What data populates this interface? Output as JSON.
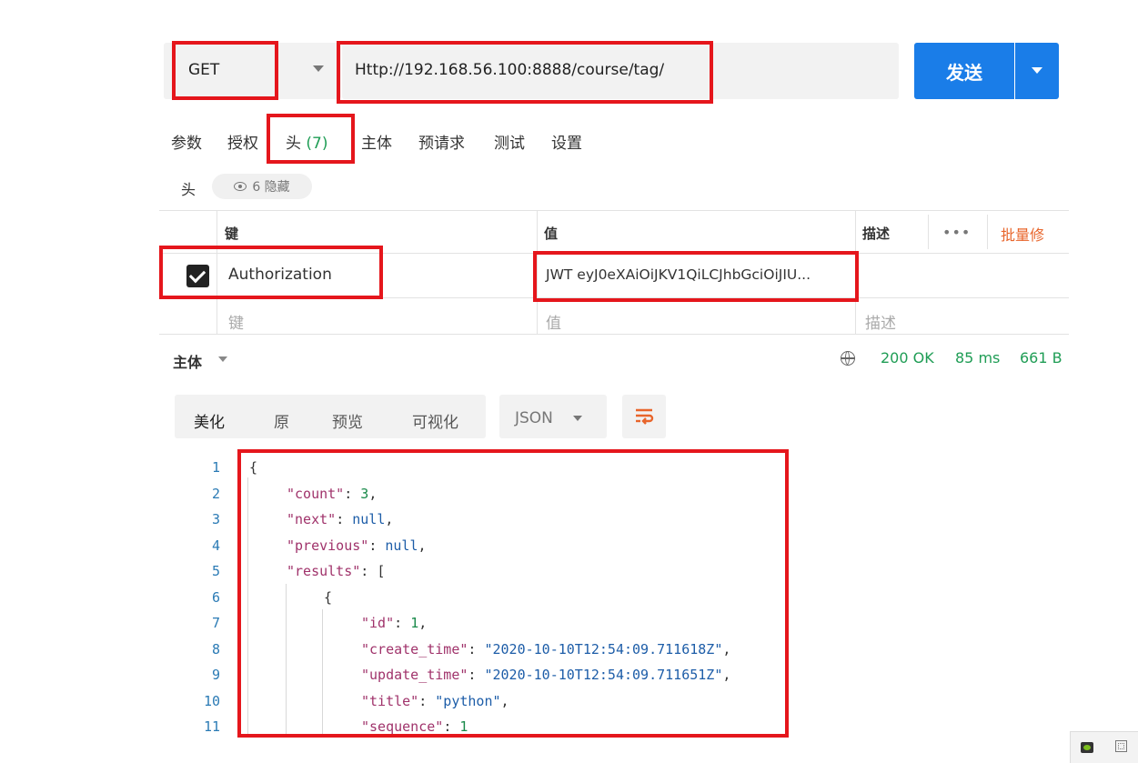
{
  "request": {
    "method": "GET",
    "url": "Http://192.168.56.100:8888/course/tag/",
    "send_label": "发送"
  },
  "tabs": [
    {
      "label": "参数"
    },
    {
      "label": "授权"
    },
    {
      "label": "头",
      "count": "(7)"
    },
    {
      "label": "主体"
    },
    {
      "label": "预请求"
    },
    {
      "label": "测试"
    },
    {
      "label": "设置"
    }
  ],
  "headers_section": {
    "label": "头",
    "hidden_pill": "6 隐藏"
  },
  "headers_table": {
    "columns": {
      "key": "键",
      "value": "值",
      "description": "描述",
      "more": "•••",
      "bulk_edit": "批量修"
    },
    "row": {
      "checked": true,
      "key": "Authorization",
      "value": "JWT eyJ0eXAiOiJKV1QiLCJhbGciOiJIU..."
    },
    "placeholder": {
      "key": "键",
      "value": "值",
      "description": "描述"
    }
  },
  "response": {
    "body_label": "主体",
    "status": "200 OK",
    "time": "85 ms",
    "size": "661 B",
    "format_tabs": [
      "美化",
      "原",
      "预览",
      "可视化"
    ],
    "format_select": "JSON",
    "line_numbers": [
      "1",
      "2",
      "3",
      "4",
      "5",
      "6",
      "7",
      "8",
      "9",
      "10",
      "11"
    ],
    "code": {
      "count_key": "\"count\"",
      "count_val": "3",
      "next_key": "\"next\"",
      "next_val": "null",
      "previous_key": "\"previous\"",
      "previous_val": "null",
      "results_key": "\"results\"",
      "id_key": "\"id\"",
      "id_val": "1",
      "create_key": "\"create_time\"",
      "create_val": "\"2020-10-10T12:54:09.711618Z\"",
      "update_key": "\"update_time\"",
      "update_val": "\"2020-10-10T12:54:09.711651Z\"",
      "title_key": "\"title\"",
      "title_val": "\"python\"",
      "sequence_key": "\"sequence\"",
      "sequence_val": "1"
    }
  },
  "colors": {
    "accent": "#1a7de8",
    "highlight": "#e5161c",
    "success": "#1f9d55",
    "warning": "#e8652b"
  }
}
